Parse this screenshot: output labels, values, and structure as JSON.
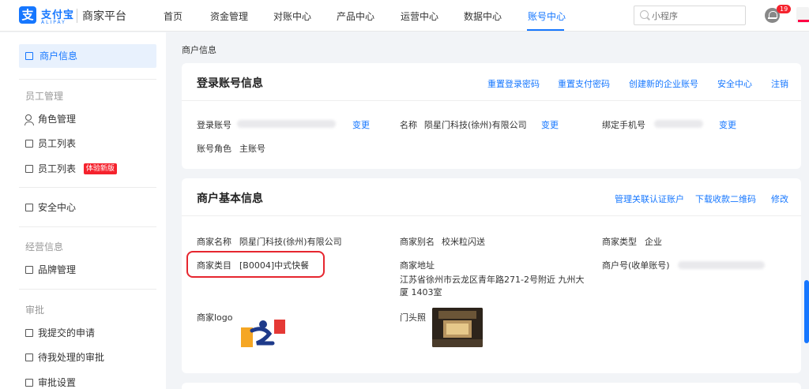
{
  "header": {
    "logo_glyph": "支",
    "logo_cn": "支付宝",
    "logo_en": "ALIPAY",
    "platform": "商家平台",
    "nav": [
      "首页",
      "资金管理",
      "对账中心",
      "产品中心",
      "运营中心",
      "数据中心",
      "账号中心"
    ],
    "active_nav": "账号中心",
    "search_placeholder": "小程序",
    "notification_count": "19"
  },
  "sidebar": {
    "merchant_info": "商户信息",
    "group_staff": "员工管理",
    "role_mgmt": "角色管理",
    "staff_list": "员工列表",
    "staff_list_new": "员工列表",
    "new_tag": "体验新版",
    "security": "安全中心",
    "group_business": "经营信息",
    "brand_mgmt": "品牌管理",
    "group_approval": "审批",
    "my_requests": "我提交的申请",
    "pending": "待我处理的审批",
    "approval_settings": "审批设置"
  },
  "breadcrumb": "商户信息",
  "login_card": {
    "title": "登录账号信息",
    "links": [
      "重置登录密码",
      "重置支付密码",
      "创建新的企业账号",
      "安全中心",
      "注销"
    ],
    "login_account_label": "登录账号",
    "change": "变更",
    "name_label": "名称",
    "name_value": "陨星门科技(徐州)有限公司",
    "phone_label": "绑定手机号",
    "role_label": "账号角色",
    "role_value": "主账号"
  },
  "basic_card": {
    "title": "商户基本信息",
    "links": [
      "管理关联认证账户",
      "下载收款二维码",
      "修改"
    ],
    "merchant_name_label": "商家名称",
    "merchant_name_value": "陨星门科技(徐州)有限公司",
    "alias_label": "商家别名",
    "alias_value": "校米粒闪送",
    "type_label": "商家类型",
    "type_value": "企业",
    "category_label": "商家类目",
    "category_value": "[B0004]中式快餐",
    "address_label": "商家地址",
    "address_line1": "江苏省徐州市云龙区青年路271-2号附近 九州大",
    "address_line2": "厦 1403室",
    "merchant_no_label": "商户号(收单账号)",
    "logo_label": "商家logo",
    "door_label": "门头照"
  },
  "colors": {
    "accent": "#1677ff",
    "highlight_box": "#e6262f",
    "badge": "#f5222d"
  }
}
